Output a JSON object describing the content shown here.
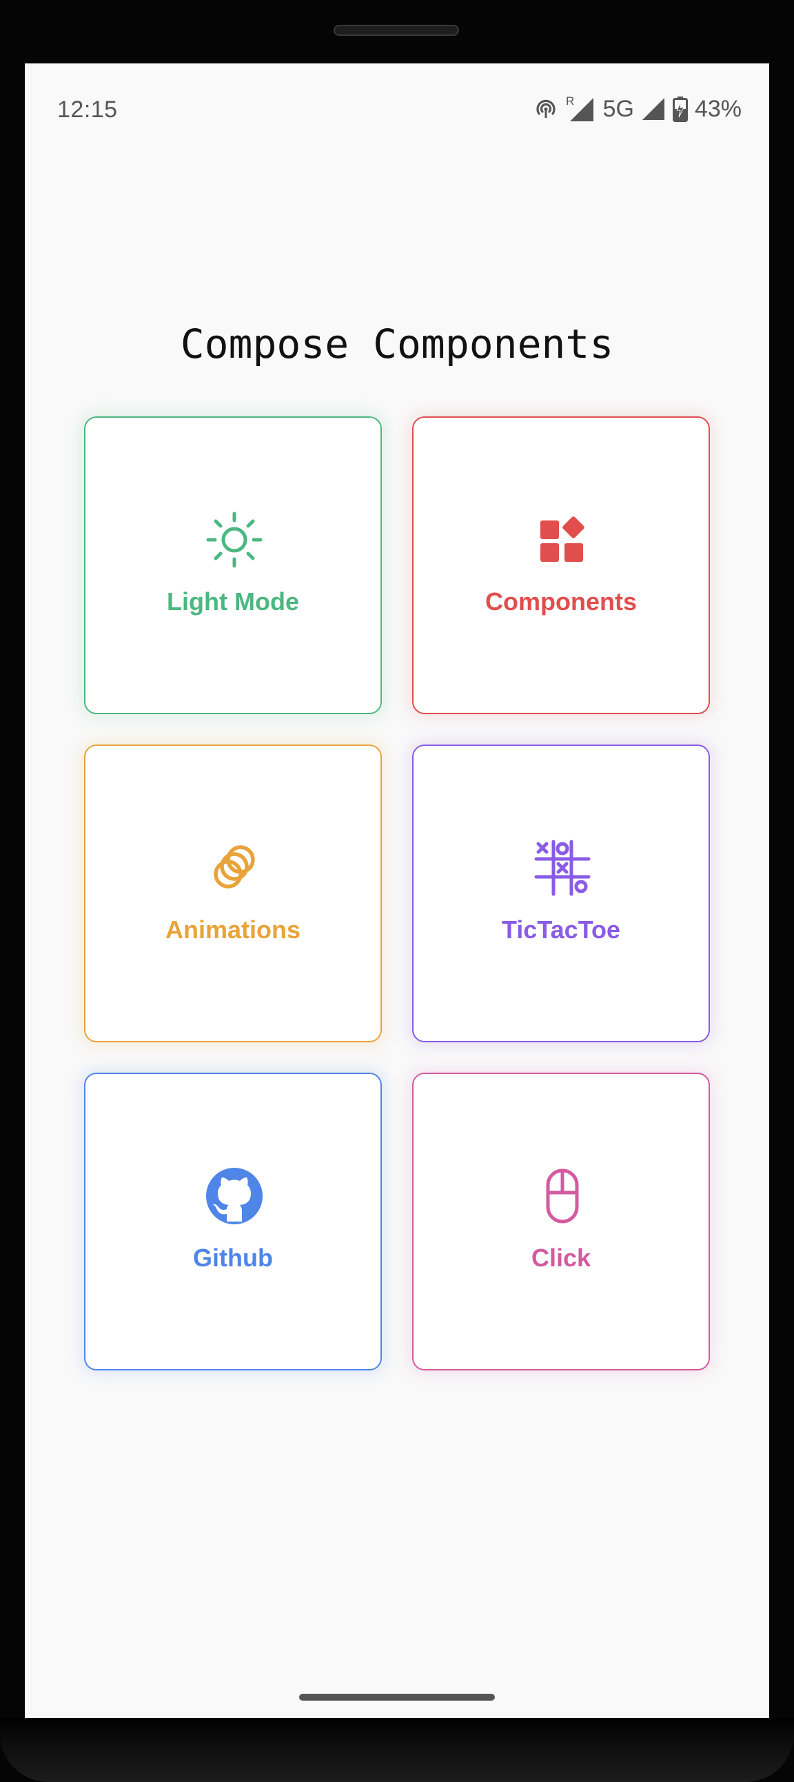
{
  "status_bar": {
    "time": "12:15",
    "roaming_indicator": "R",
    "network": "5G",
    "battery": "43%",
    "icons": [
      "hotspot-icon",
      "signal-roaming-icon",
      "signal-icon",
      "battery-charging-icon"
    ]
  },
  "page": {
    "title": "Compose Components"
  },
  "cards": [
    {
      "label": "Light Mode",
      "icon": "sun-icon",
      "color": "#4cb781",
      "glow": "rgba(76,183,129,0.14)"
    },
    {
      "label": "Components",
      "icon": "widgets-icon",
      "color": "#e04e4e",
      "glow": "rgba(224,78,78,0.12)"
    },
    {
      "label": "Animations",
      "icon": "animation-rings-icon",
      "color": "#e8a33a",
      "glow": "rgba(232,163,58,0.14)"
    },
    {
      "label": "TicTacToe",
      "icon": "tictactoe-icon",
      "color": "#8a5ce6",
      "glow": "rgba(138,92,230,0.14)"
    },
    {
      "label": "Github",
      "icon": "github-icon",
      "color": "#4f85e6",
      "glow": "rgba(79,133,230,0.14)"
    },
    {
      "label": "Click",
      "icon": "mouse-icon",
      "color": "#d45aa0",
      "glow": "rgba(212,90,160,0.13)"
    }
  ]
}
